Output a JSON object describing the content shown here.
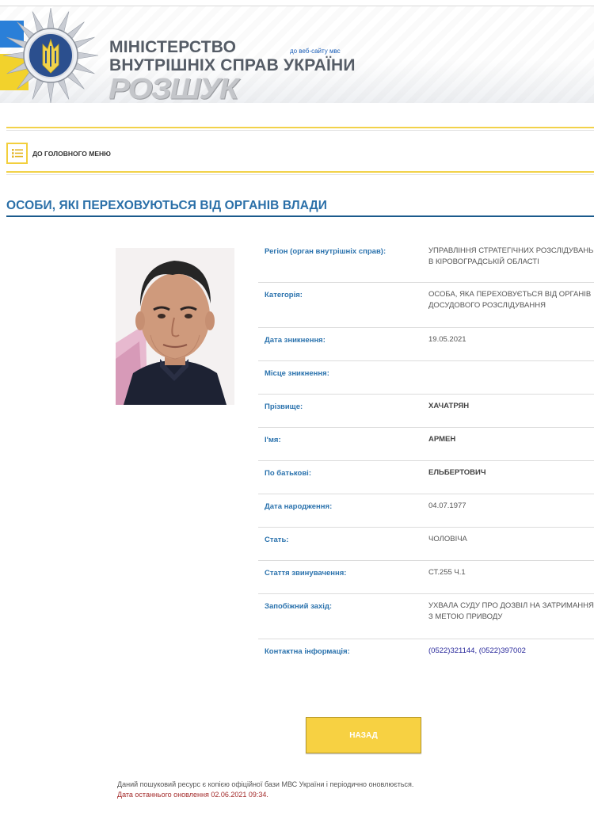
{
  "header": {
    "ministry_line1": "Міністерство",
    "ministry_line2": "внутрішніх справ України",
    "site_link": "до веб-сайту мвс",
    "section_logo": "РОЗШУК",
    "emblem_icon": "police-star-emblem-icon",
    "colors": {
      "flag_blue": "#2a7fd8",
      "flag_yellow": "#f2d22c"
    }
  },
  "nav": {
    "menu_icon": "list-menu-icon",
    "main_menu_label": "До головного меню"
  },
  "page": {
    "title": "Особи, які переховуються від органів влади",
    "accent_color": "#2a6fa8"
  },
  "person": {
    "photo_icon": "person-photo",
    "fields": [
      {
        "label": "Регіон (орган внутрішніх справ):",
        "value": "Управління стратегічних розслідувань в Кіровоградській області"
      },
      {
        "label": "Категорія:",
        "value": "Особа, яка переховується від органів досудового розслідування"
      },
      {
        "label": "Дата зникнення:",
        "value": "19.05.2021"
      },
      {
        "label": "Місце зникнення:",
        "value": ""
      },
      {
        "label": "Прізвище:",
        "value": "Хачатрян"
      },
      {
        "label": "І'мя:",
        "value": "Армен"
      },
      {
        "label": "По батькові:",
        "value": "Ельбертович"
      },
      {
        "label": "Дата народження:",
        "value": "04.07.1977"
      },
      {
        "label": "Стать:",
        "value": "Чоловіча"
      },
      {
        "label": "Стаття звинувачення:",
        "value": "ст.255 ч.1"
      },
      {
        "label": "Запобіжний захід:",
        "value": "Ухвала суду про дозвіл на затримання з метою приводу"
      },
      {
        "label": "Контактна інформація:",
        "value": "(0522)321144, (0522)397002"
      }
    ]
  },
  "actions": {
    "back_label": "Назад"
  },
  "footer": {
    "note": "Даний пошуковий ресурс є копією офіційної бази МВС України і періодично оновлюється.",
    "updated": "Дата останнього оновлення 02.06.2021 09:34."
  }
}
